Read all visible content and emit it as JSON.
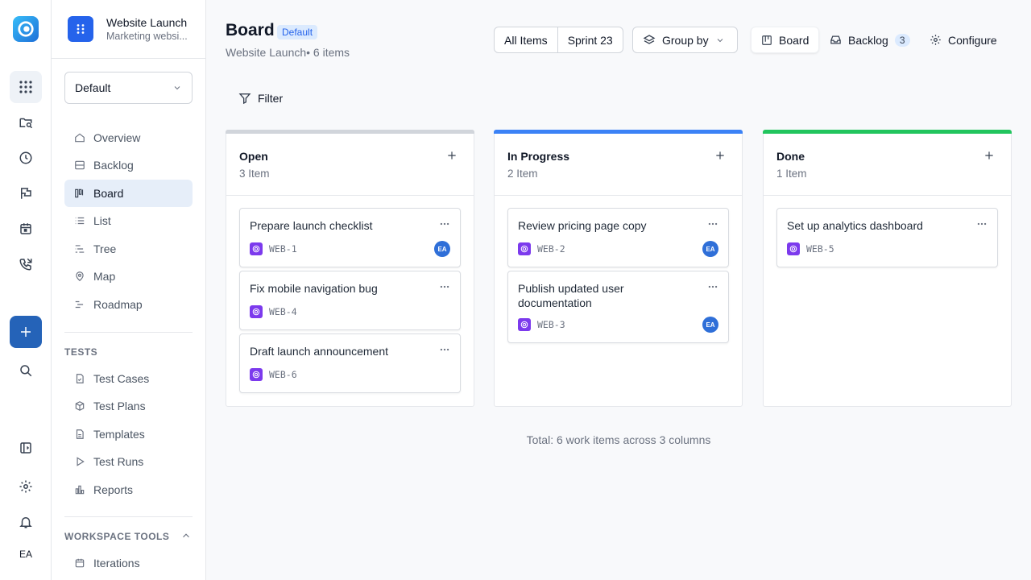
{
  "rail": {
    "avatar": "EA",
    "icons": [
      "apps-grid-icon",
      "folder-search-icon",
      "clock-icon",
      "flag-icon",
      "calendar-icon",
      "phone-icon",
      "plus-icon",
      "search-icon",
      "sidebar-toggle-icon",
      "settings-icon",
      "bell-icon"
    ]
  },
  "project": {
    "name": "Website Launch",
    "subtitle": "Marketing websi..."
  },
  "sidebar": {
    "view_select": "Default",
    "nav": [
      {
        "label": "Overview",
        "icon": "home-icon"
      },
      {
        "label": "Backlog",
        "icon": "inbox-icon"
      },
      {
        "label": "Board",
        "icon": "board-icon"
      },
      {
        "label": "List",
        "icon": "list-icon"
      },
      {
        "label": "Tree",
        "icon": "tree-icon"
      },
      {
        "label": "Map",
        "icon": "map-pin-icon"
      },
      {
        "label": "Roadmap",
        "icon": "roadmap-icon"
      }
    ],
    "tests_label": "TESTS",
    "tests": [
      {
        "label": "Test Cases",
        "icon": "file-check-icon"
      },
      {
        "label": "Test Plans",
        "icon": "package-icon"
      },
      {
        "label": "Templates",
        "icon": "file-icon"
      },
      {
        "label": "Test Runs",
        "icon": "play-icon"
      },
      {
        "label": "Reports",
        "icon": "bar-chart-icon"
      }
    ],
    "workspace_label": "WORKSPACE TOOLS",
    "workspace": [
      {
        "label": "Iterations",
        "icon": "calendar-icon"
      }
    ]
  },
  "header": {
    "title": "Board",
    "badge": "Default",
    "subtitle": "Website Launch• 6 items",
    "segments": [
      "All Items",
      "Sprint 23"
    ],
    "group_by": "Group by",
    "board": "Board",
    "backlog": "Backlog",
    "backlog_count": "3",
    "configure": "Configure",
    "filter": "Filter"
  },
  "colors": {
    "open": "#d1d5db",
    "in_progress": "#3b82f6",
    "done": "#22c55e",
    "accent": "#2563eb",
    "type": "#7c3aed"
  },
  "columns": [
    {
      "title": "Open",
      "count": "3 Item",
      "cards": [
        {
          "title": "Prepare launch checklist",
          "key": "WEB-1",
          "assignee": "EA"
        },
        {
          "title": "Fix mobile navigation bug",
          "key": "WEB-4",
          "assignee": ""
        },
        {
          "title": "Draft launch announcement",
          "key": "WEB-6",
          "assignee": ""
        }
      ]
    },
    {
      "title": "In Progress",
      "count": "2 Item",
      "cards": [
        {
          "title": "Review pricing page copy",
          "key": "WEB-2",
          "assignee": "EA"
        },
        {
          "title": "Publish updated user documentation",
          "key": "WEB-3",
          "assignee": "EA"
        }
      ]
    },
    {
      "title": "Done",
      "count": "1 Item",
      "cards": [
        {
          "title": "Set up analytics dashboard",
          "key": "WEB-5",
          "assignee": ""
        }
      ]
    }
  ],
  "footer": {
    "total": "Total: 6 work items across 3 columns"
  }
}
